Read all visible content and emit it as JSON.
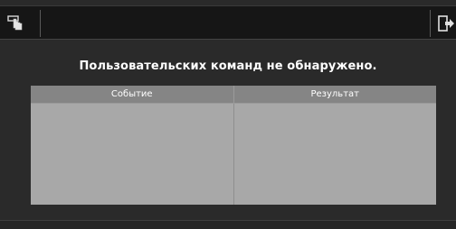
{
  "toolbar": {
    "left_icon": "hand-pointer-icon",
    "right_icon": "exit-icon"
  },
  "message": "Пользовательских команд не обнаружено.",
  "table": {
    "columns": [
      "Событие",
      "Результат"
    ],
    "rows": []
  },
  "colors": {
    "background": "#2a2a2a",
    "toolbar": "#161616",
    "table_header": "#858585",
    "table_body": "#a8a8a8",
    "text": "#ffffff"
  }
}
